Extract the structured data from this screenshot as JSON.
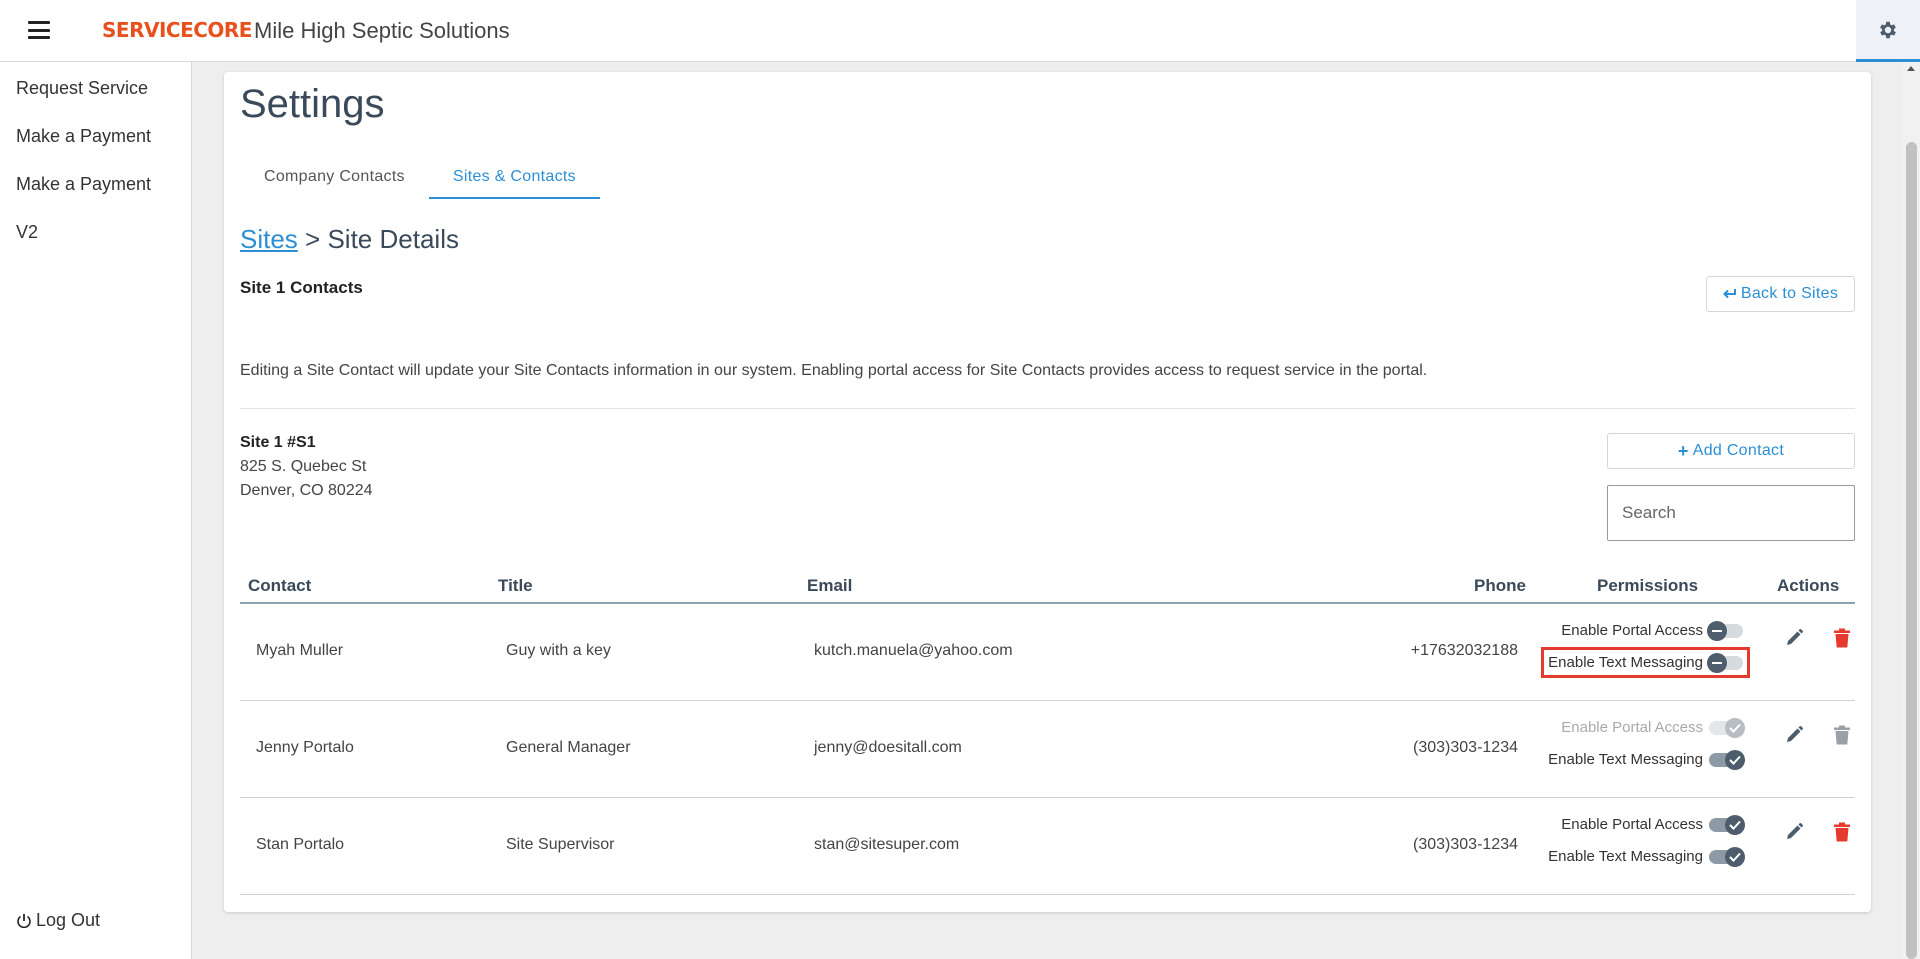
{
  "header": {
    "logo_text": "SERVICECORE",
    "company_name": "Mile High Septic Solutions"
  },
  "sidebar": {
    "items": [
      {
        "label": "Request Service"
      },
      {
        "label": "Make a Payment"
      },
      {
        "label": "Make a Payment V2"
      }
    ],
    "logout_label": "Log Out"
  },
  "page": {
    "title": "Settings",
    "tabs": [
      {
        "label": "Company Contacts",
        "active": false
      },
      {
        "label": "Sites & Contacts",
        "active": true
      }
    ],
    "breadcrumb": {
      "link": "Sites",
      "separator": ">",
      "current": "Site Details"
    },
    "section_title": "Site 1 Contacts",
    "back_button": "Back to Sites",
    "info_text": "Editing a Site Contact will update your Site Contacts information in our system. Enabling portal access for Site Contacts provides access to request service in the portal.",
    "site": {
      "name": "Site 1 #S1",
      "address_line1": "825 S. Quebec St",
      "address_line2": "Denver, CO 80224"
    },
    "add_contact_button": "Add Contact",
    "search_placeholder": "Search"
  },
  "table": {
    "headers": {
      "contact": "Contact",
      "title": "Title",
      "email": "Email",
      "phone": "Phone",
      "permissions": "Permissions",
      "actions": "Actions"
    },
    "rows": [
      {
        "contact": "Myah Muller",
        "title": "Guy with a key",
        "email": "kutch.manuela@yahoo.com",
        "phone": "+17632032188",
        "portal_label": "Enable Portal Access",
        "portal_enabled": false,
        "text_label": "Enable Text Messaging",
        "text_enabled": false
      },
      {
        "contact": "Jenny Portalo",
        "title": "General Manager",
        "email": "jenny@doesitall.com",
        "phone": "(303)303-1234",
        "portal_label": "Enable Portal Access",
        "portal_enabled": true,
        "text_label": "Enable Text Messaging",
        "text_enabled": true
      },
      {
        "contact": "Stan Portalo",
        "title": "Site Supervisor",
        "email": "stan@sitesuper.com",
        "phone": "(303)303-1234",
        "portal_label": "Enable Portal Access",
        "portal_enabled": true,
        "text_label": "Enable Text Messaging",
        "text_enabled": true
      }
    ]
  },
  "colors": {
    "accent": "#2b8fd6",
    "brand": "#e8501e",
    "delete": "#e53a2e",
    "highlight": "#e53a2e"
  }
}
